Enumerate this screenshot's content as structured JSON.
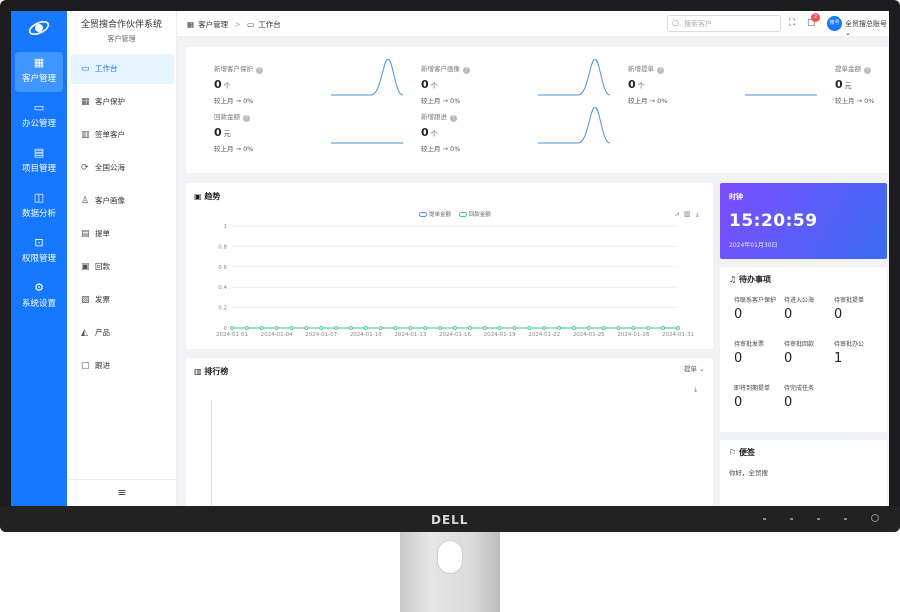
{
  "app": {
    "title": "全贸搜合作伙伴系统",
    "subtitle": "客户管理"
  },
  "rail": [
    {
      "label": "客户管理",
      "icon": "building-icon",
      "active": true
    },
    {
      "label": "办公管理",
      "icon": "briefcase-icon"
    },
    {
      "label": "项目管理",
      "icon": "book-icon"
    },
    {
      "label": "数据分析",
      "icon": "chart-board-icon"
    },
    {
      "label": "权限管理",
      "icon": "lock-icon"
    },
    {
      "label": "系统设置",
      "icon": "gear-icon"
    }
  ],
  "menu": [
    {
      "label": "工作台",
      "icon": "monitor-icon",
      "active": true
    },
    {
      "label": "客户保护",
      "icon": "building-icon"
    },
    {
      "label": "签单客户",
      "icon": "office-icon"
    },
    {
      "label": "全国公海",
      "icon": "sync-icon"
    },
    {
      "label": "客户画像",
      "icon": "user-icon"
    },
    {
      "label": "提单",
      "icon": "file-icon"
    },
    {
      "label": "回款",
      "icon": "money-icon"
    },
    {
      "label": "发票",
      "icon": "invoice-icon"
    },
    {
      "label": "产品",
      "icon": "bag-icon"
    },
    {
      "label": "跟进",
      "icon": "message-icon"
    }
  ],
  "breadcrumb": {
    "root": "客户管理",
    "current": "工作台"
  },
  "topbar": {
    "search_placeholder": "搜索客户",
    "notification_count": "2",
    "avatar_text": "账号",
    "account_name": "全贸搜总账号"
  },
  "stats": [
    {
      "label": "新增客户保护",
      "value": "0",
      "unit": "个",
      "compare": "较上月 → 0%"
    },
    {
      "label": "新增客户画像",
      "value": "0",
      "unit": "个",
      "compare": "较上月 → 0%"
    },
    {
      "label": "新增提单",
      "value": "0",
      "unit": "个",
      "compare": "较上月 → 0%"
    },
    {
      "label": "提单金额",
      "value": "0",
      "unit": "元",
      "compare": "较上月 → 0%"
    },
    {
      "label": "回款金额",
      "value": "0",
      "unit": "元",
      "compare": "较上月 → 0%"
    },
    {
      "label": "新增跟进",
      "value": "0",
      "unit": "个",
      "compare": "较上月 → 0%"
    }
  ],
  "trend": {
    "title": "趋势",
    "legend": [
      "提单金额",
      "回款金额"
    ]
  },
  "rank": {
    "title": "排行榜",
    "select": "提单"
  },
  "clock": {
    "header": "时钟",
    "time": "15:20:59",
    "date": "2024年01月30日"
  },
  "todo": {
    "title": "待办事项",
    "items": [
      {
        "label": "待联系客户保护",
        "value": "0"
      },
      {
        "label": "待进入公海",
        "value": "0"
      },
      {
        "label": "待审批提单",
        "value": "0"
      },
      {
        "label": "待审批发票",
        "value": "0"
      },
      {
        "label": "待审批回款",
        "value": "0"
      },
      {
        "label": "待审批办公",
        "value": "1"
      },
      {
        "label": "即将到期提单",
        "value": "0"
      },
      {
        "label": "待完成任务",
        "value": "0"
      }
    ]
  },
  "notes": {
    "title": "便签",
    "body": "你好，全贸搜"
  },
  "monitor": {
    "brand": "DELL"
  },
  "colors": {
    "primary": "#1677ff",
    "series_submit": "#4a90e2",
    "series_payment": "#3cc58c"
  },
  "chart_data": {
    "type": "line",
    "x": [
      "2024-01-01",
      "2024-01-02",
      "2024-01-03",
      "2024-01-04",
      "2024-01-05",
      "2024-01-06",
      "2024-01-07",
      "2024-01-08",
      "2024-01-09",
      "2024-01-10",
      "2024-01-11",
      "2024-01-12",
      "2024-01-13",
      "2024-01-14",
      "2024-01-15",
      "2024-01-16",
      "2024-01-17",
      "2024-01-18",
      "2024-01-19",
      "2024-01-20",
      "2024-01-21",
      "2024-01-22",
      "2024-01-23",
      "2024-01-24",
      "2024-01-25",
      "2024-01-26",
      "2024-01-27",
      "2024-01-28",
      "2024-01-29",
      "2024-01-30",
      "2024-01-31"
    ],
    "xticks": [
      "2024-01-01",
      "2024-01-04",
      "2024-01-07",
      "2024-01-10",
      "2024-01-13",
      "2024-01-16",
      "2024-01-19",
      "2024-01-22",
      "2024-01-25",
      "2024-01-28",
      "2024-01-31"
    ],
    "yticks": [
      0,
      0.2,
      0.4,
      0.6,
      0.8,
      1
    ],
    "ylim": [
      0,
      1
    ],
    "series": [
      {
        "name": "提单金额",
        "values": [
          0,
          0,
          0,
          0,
          0,
          0,
          0,
          0,
          0,
          0,
          0,
          0,
          0,
          0,
          0,
          0,
          0,
          0,
          0,
          0,
          0,
          0,
          0,
          0,
          0,
          0,
          0,
          0,
          0,
          0,
          0
        ]
      },
      {
        "name": "回款金额",
        "values": [
          0,
          0,
          0,
          0,
          0,
          0,
          0,
          0,
          0,
          0,
          0,
          0,
          0,
          0,
          0,
          0,
          0,
          0,
          0,
          0,
          0,
          0,
          0,
          0,
          0,
          0,
          0,
          0,
          0,
          0,
          0
        ]
      }
    ],
    "legend": "top-center",
    "grid": true
  }
}
